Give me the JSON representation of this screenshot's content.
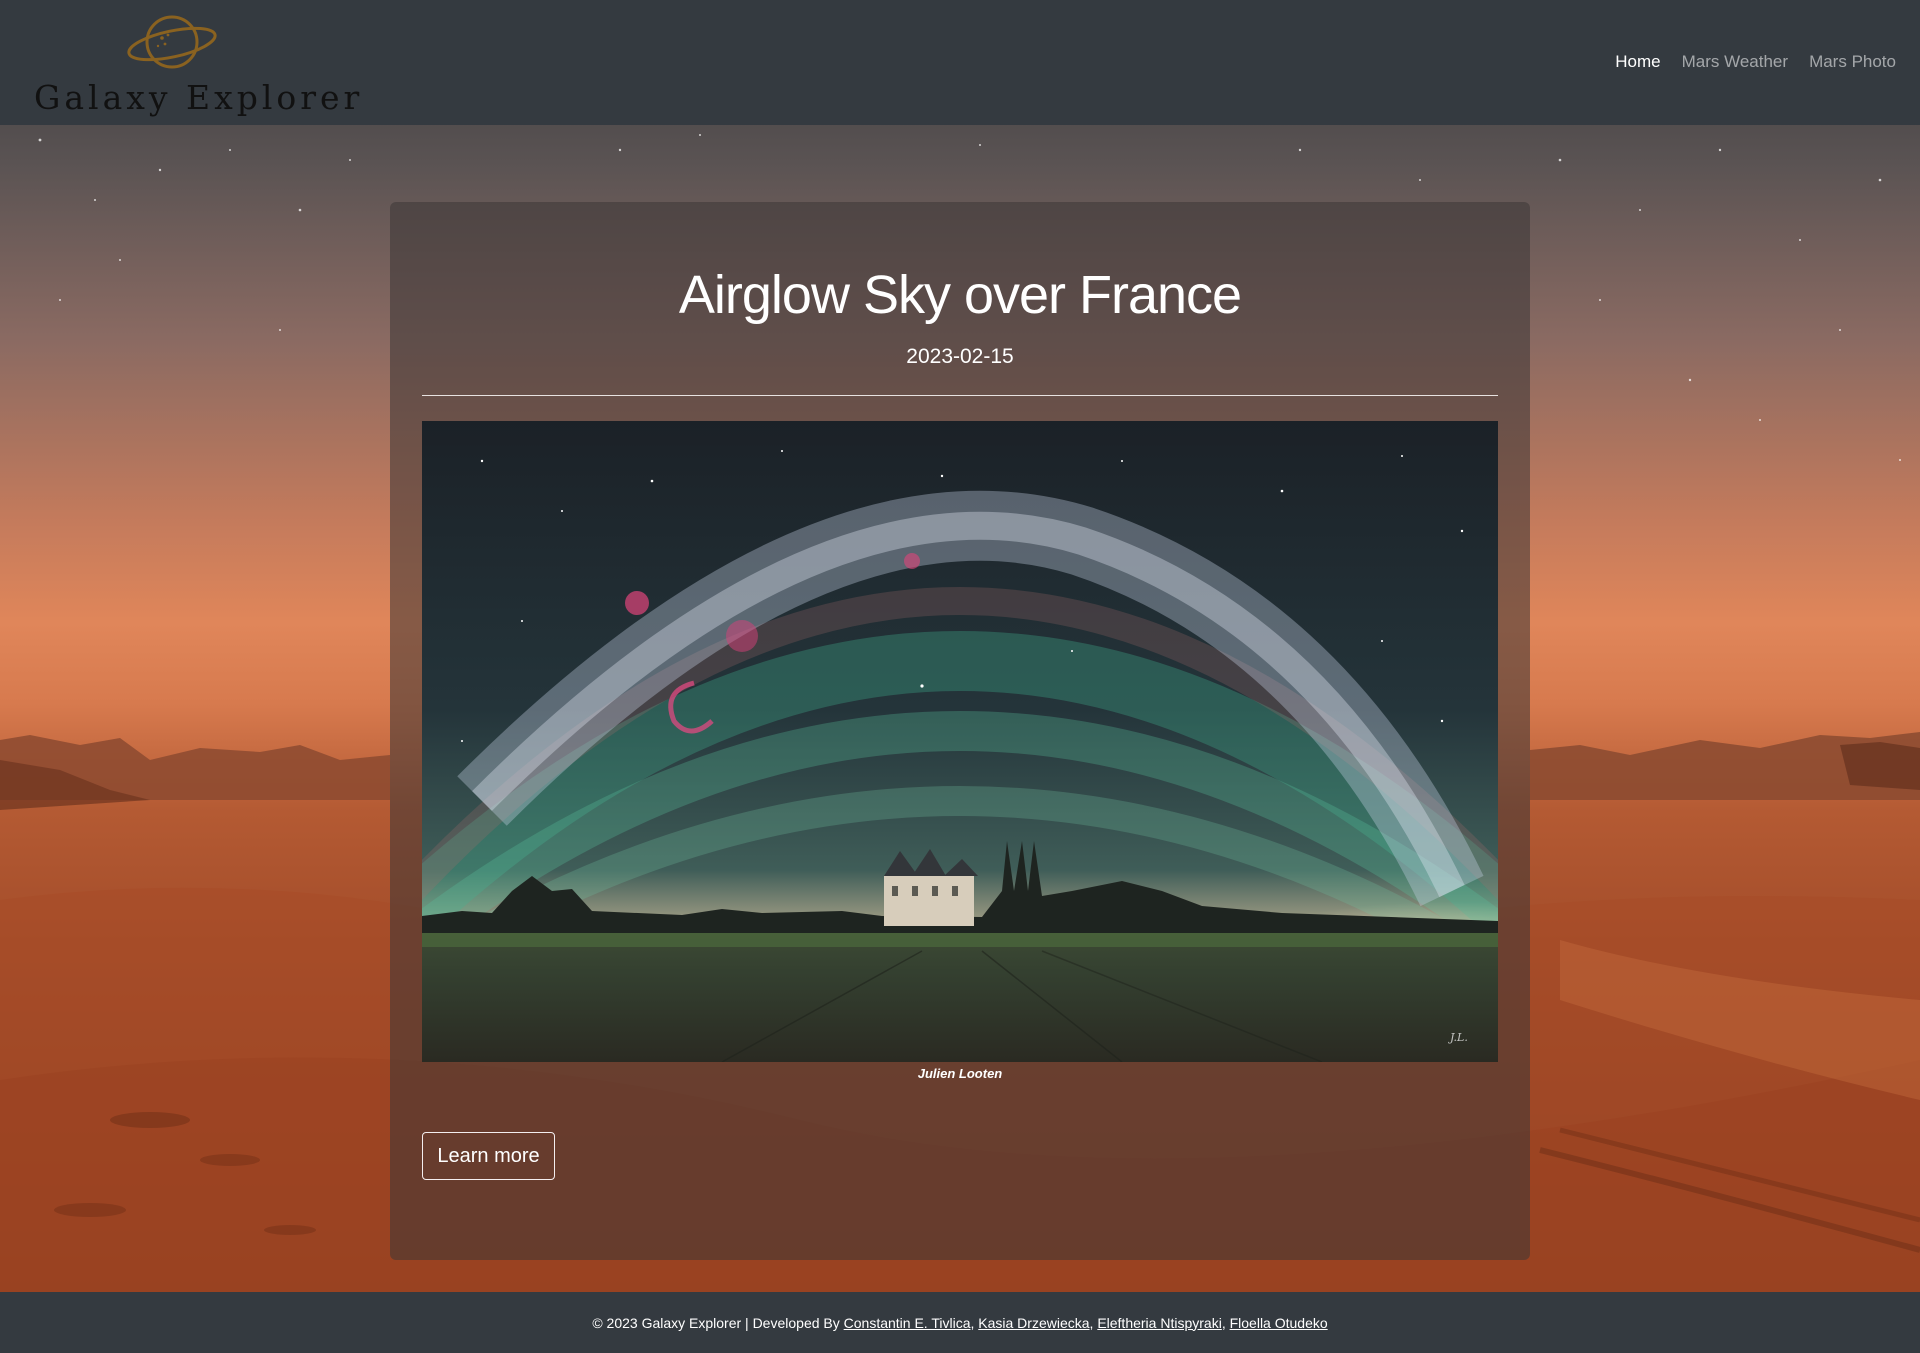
{
  "brand": {
    "name": "Galaxy Explorer",
    "logo_icon": "planet-ring-icon",
    "logo_color": "#8a6220"
  },
  "nav": {
    "items": [
      {
        "label": "Home",
        "active": true
      },
      {
        "label": "Mars Weather",
        "active": false
      },
      {
        "label": "Mars Photo",
        "active": false
      }
    ]
  },
  "apod": {
    "title": "Airglow Sky over France",
    "date": "2023-02-15",
    "credit": "Julien Looten",
    "button_label": "Learn more"
  },
  "footer": {
    "prefix": "© 2023 Galaxy Explorer | Developed By",
    "separator": ",",
    "developers": [
      "Constantin E. Tivlica",
      "Kasia Drzewiecka",
      "Eleftheria Ntispyraki",
      "Floella Otudeko"
    ]
  },
  "colors": {
    "header_bg": "#343a40",
    "footer_bg": "#343a40",
    "nav_active": "#ffffff",
    "nav_inactive": "rgba(255,255,255,0.55)"
  }
}
